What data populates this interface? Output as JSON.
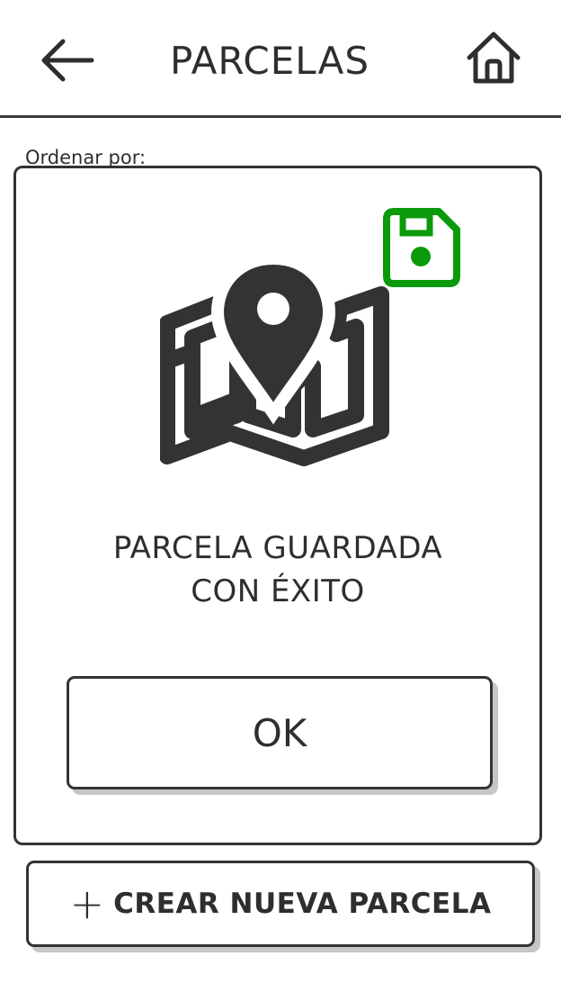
{
  "header": {
    "title": "PARCELAS",
    "back_icon": "arrow-left-icon",
    "home_icon": "home-icon"
  },
  "sort": {
    "label": "Ordenar por:"
  },
  "dialog": {
    "map_icon": "map-marker-icon",
    "save_icon": "floppy-disk-icon",
    "save_icon_color": "#0a9a0a",
    "message_line1": "PARCELA GUARDADA",
    "message_line2": "CON ÉXITO",
    "ok_label": "OK"
  },
  "footer": {
    "create_icon": "plus-icon",
    "create_label": "CREAR NUEVA PARCELA"
  }
}
